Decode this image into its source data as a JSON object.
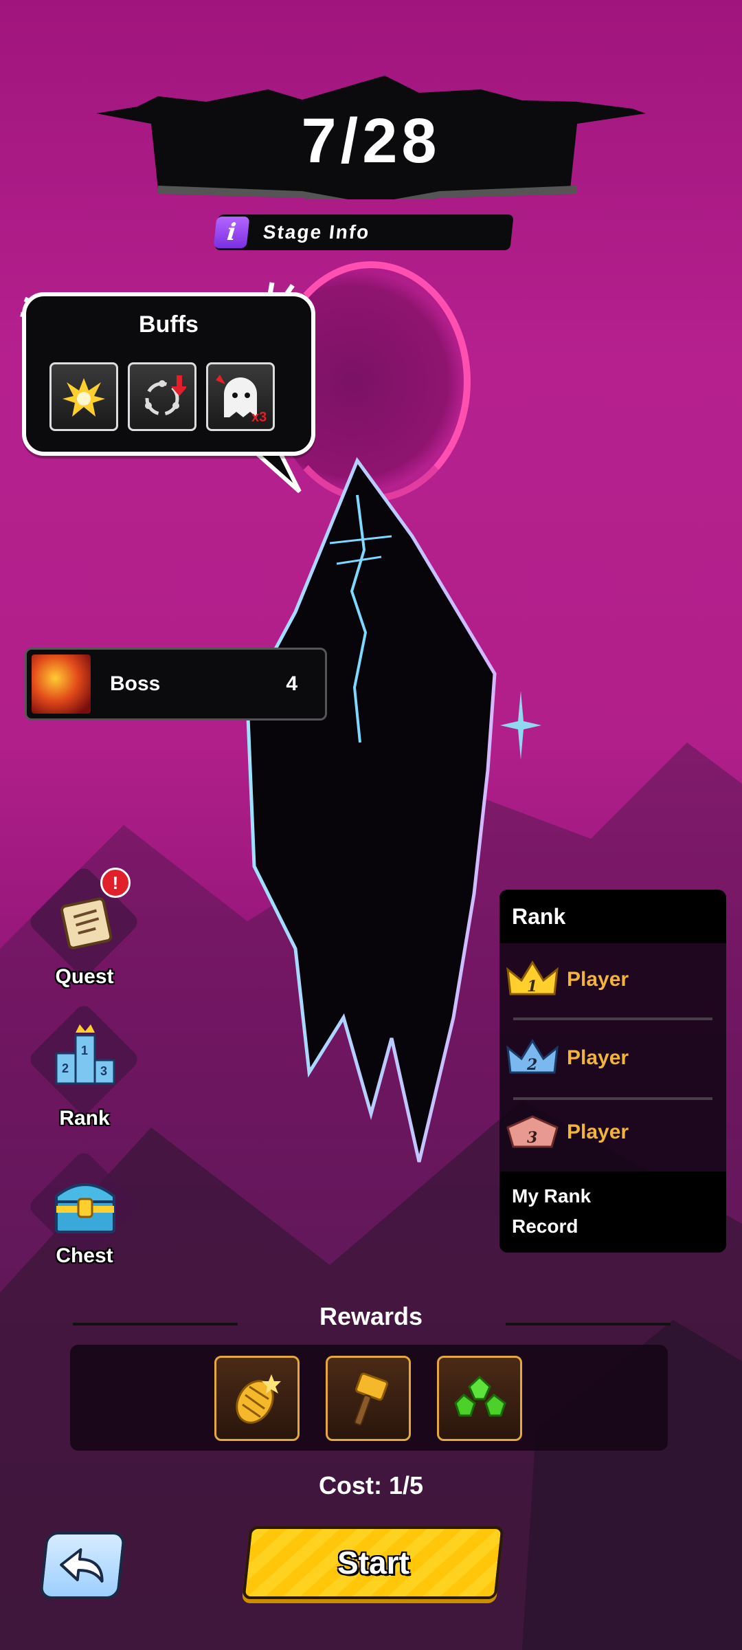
{
  "stage": {
    "title": "7/28",
    "subtitle": "Stage Info"
  },
  "modifiers": {
    "title": "Buffs",
    "items": [
      {
        "icon": "power-up-icon"
      },
      {
        "icon": "cycle-down-icon"
      },
      {
        "icon": "angry-ghost-icon",
        "multiplier": "x3"
      }
    ]
  },
  "boss": {
    "name": "Boss",
    "level": "4"
  },
  "side_menu": [
    {
      "label": "Quest",
      "icon": "scroll-icon",
      "alert": "!"
    },
    {
      "label": "Rank",
      "icon": "podium-icon"
    },
    {
      "label": "Chest",
      "icon": "treasure-chest-icon"
    }
  ],
  "ranking": {
    "title": "Rank",
    "rows": [
      {
        "place": "1",
        "value": "Player"
      },
      {
        "place": "2",
        "value": "Player"
      },
      {
        "place": "3",
        "value": "Player"
      }
    ],
    "footer_line1": "My Rank",
    "footer_line2": "Record"
  },
  "rewards": {
    "title": "Rewards",
    "items": [
      {
        "icon": "golden-pinecone-icon"
      },
      {
        "icon": "golden-hammer-icon"
      },
      {
        "icon": "green-gems-icon"
      }
    ]
  },
  "cost": "Cost: 1/5",
  "buttons": {
    "back_icon": "back-arrow-icon",
    "start": "Start"
  },
  "colors": {
    "accent_yellow": "#ffcc1a",
    "reward_border": "#e5a83a",
    "rank_value": "#f2b43a",
    "bg_magenta": "#b11f8a"
  }
}
